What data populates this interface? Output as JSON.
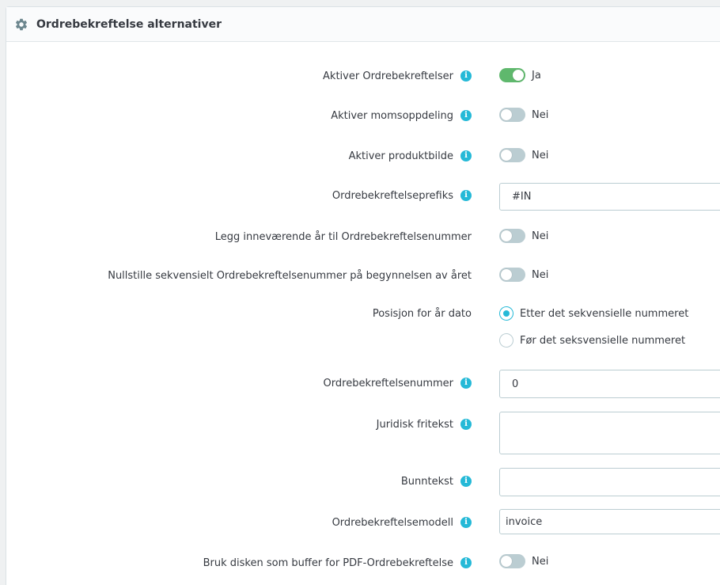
{
  "panel": {
    "title": "Ordrebekreftelse alternativer",
    "icon": "gear-icon"
  },
  "fields": {
    "enable_invoices": {
      "label": "Aktiver Ordrebekreftelser",
      "state": "Ja",
      "on": true
    },
    "enable_tax_breakdown": {
      "label": "Aktiver momsoppdeling",
      "state": "Nei",
      "on": false
    },
    "enable_product_image": {
      "label": "Aktiver produktbilde",
      "state": "Nei",
      "on": false
    },
    "invoice_prefix": {
      "label": "Ordrebekreftelseprefiks",
      "value": "#IN"
    },
    "add_current_year": {
      "label": "Legg inneværende år til Ordrebekreftelsenummer",
      "state": "Nei",
      "on": false
    },
    "reset_sequence": {
      "label": "Nullstille sekvensielt Ordrebekreftelsenummer på begynnelsen av året",
      "state": "Nei",
      "on": false
    },
    "year_position": {
      "label": "Posisjon for år dato",
      "options": [
        "Etter det sekvensielle nummeret",
        "Før det seksvensielle nummeret"
      ],
      "selected": "Etter det sekvensielle nummeret"
    },
    "invoice_number": {
      "label": "Ordrebekreftelsenummer",
      "value": "0"
    },
    "legal_text": {
      "label": "Juridisk fritekst",
      "value": ""
    },
    "footer_text": {
      "label": "Bunntekst",
      "value": ""
    },
    "invoice_model": {
      "label": "Ordrebekreftelsemodell",
      "value": "invoice"
    },
    "disk_cache": {
      "label": "Bruk disken som buffer for PDF-Ordrebekreftelse",
      "state": "Nei",
      "on": false
    }
  },
  "info_glyph": "i",
  "colors": {
    "accent": "#25b9d7",
    "switch_on": "#5fb86d",
    "switch_off": "#bbcdd2"
  }
}
